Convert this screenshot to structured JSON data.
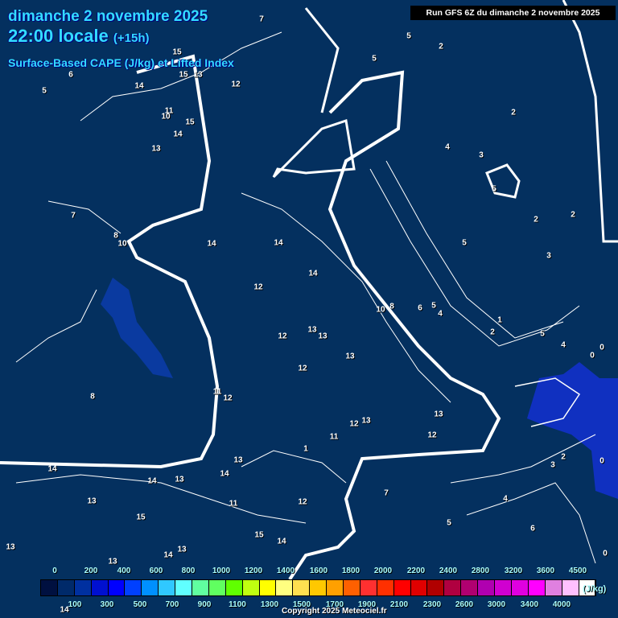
{
  "header": {
    "date": "dimanche 2 novembre 2025",
    "time": "22:00 locale",
    "lead": "(+15h)",
    "parameter": "Surface-Based CAPE (J/kg) et Lifted Index",
    "run": "Run GFS 6Z du dimanche 2 novembre 2025"
  },
  "map_labels": [
    "7",
    "5",
    "2",
    "5",
    "5",
    "6",
    "15",
    "15",
    "13",
    "14",
    "12",
    "11",
    "10",
    "15",
    "14",
    "13",
    "4",
    "3",
    "2",
    "5",
    "7",
    "8",
    "10",
    "14",
    "14",
    "12",
    "14",
    "2",
    "3",
    "2",
    "5",
    "12",
    "13",
    "13",
    "13",
    "12",
    "10",
    "8",
    "6",
    "5",
    "4",
    "2",
    "1",
    "5",
    "4",
    "0",
    "8",
    "11",
    "12",
    "12",
    "13",
    "13",
    "12",
    "11",
    "1",
    "0",
    "14",
    "13",
    "14",
    "11",
    "12",
    "7",
    "13",
    "14",
    "15",
    "15",
    "14",
    "13",
    "4",
    "5",
    "6",
    "3",
    "2",
    "0",
    "0",
    "13",
    "13",
    "14",
    "13",
    "14"
  ],
  "colorbar": {
    "colors": [
      "#001040",
      "#002a6a",
      "#0030a0",
      "#0010d0",
      "#0000ff",
      "#0040ff",
      "#0090ff",
      "#30c8ff",
      "#60ffff",
      "#60ffa0",
      "#60ff60",
      "#60ff00",
      "#c0ff10",
      "#ffff00",
      "#ffff80",
      "#ffe050",
      "#ffc800",
      "#ffa000",
      "#ff6000",
      "#ff3030",
      "#ff3000",
      "#ff0000",
      "#e00000",
      "#b00000",
      "#b00040",
      "#b00070",
      "#b000b0",
      "#d000d0",
      "#e000e0",
      "#ff00ff",
      "#e080e0",
      "#ffc0ff",
      "#ffffff"
    ],
    "top_ticks": [
      "0",
      "200",
      "400",
      "600",
      "800",
      "1000",
      "1200",
      "1400",
      "1600",
      "1800",
      "2000",
      "2200",
      "2400",
      "2800",
      "3200",
      "3600",
      "4500"
    ],
    "bottom_ticks": [
      "100",
      "300",
      "500",
      "700",
      "900",
      "1100",
      "1300",
      "1500",
      "1700",
      "1900",
      "2100",
      "2300",
      "2600",
      "3000",
      "3400",
      "4000"
    ],
    "unit": "(J/kg)"
  },
  "copyright": "Copyright 2025 Meteociel.fr"
}
